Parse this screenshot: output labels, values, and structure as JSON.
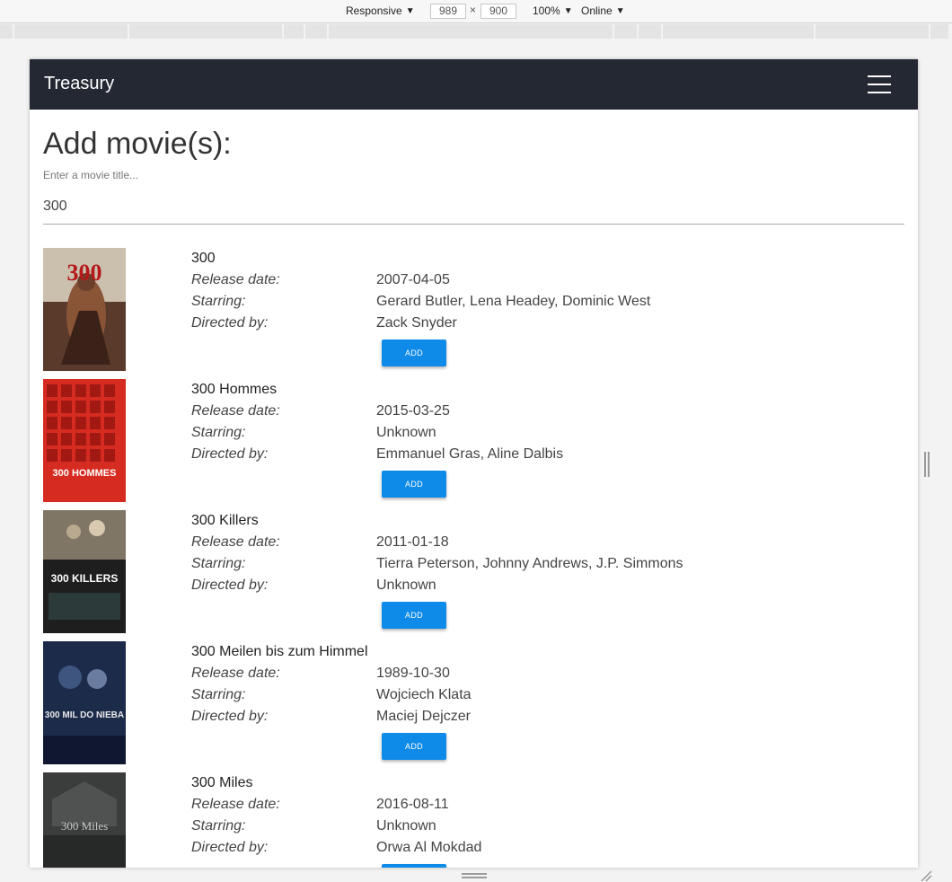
{
  "devtools": {
    "device_mode": "Responsive",
    "width": "989",
    "height": "900",
    "times": "×",
    "zoom": "100%",
    "throttle": "Online",
    "caret": "▼"
  },
  "app": {
    "brand": "Treasury"
  },
  "page": {
    "title": "Add movie(s):",
    "search_label": "Enter a movie title...",
    "search_value": "300"
  },
  "labels": {
    "release": "Release date:",
    "starring": "Starring:",
    "directed": "Directed by:",
    "add": "ADD"
  },
  "movies": [
    {
      "title": "300",
      "release": "2007-04-05",
      "starring": "Gerard Butler, Lena Headey, Dominic West",
      "directed": "Zack Snyder",
      "poster_text": "300"
    },
    {
      "title": "300 Hommes",
      "release": "2015-03-25",
      "starring": "Unknown",
      "directed": "Emmanuel Gras, Aline Dalbis",
      "poster_text": "300 HOMMES"
    },
    {
      "title": "300 Killers",
      "release": "2011-01-18",
      "starring": "Tierra Peterson, Johnny Andrews, J.P. Simmons",
      "directed": "Unknown",
      "poster_text": "300 KILLERS"
    },
    {
      "title": "300 Meilen bis zum Himmel",
      "release": "1989-10-30",
      "starring": "Wojciech Klata",
      "directed": "Maciej Dejczer",
      "poster_text": "300 MIL DO NIEBA"
    },
    {
      "title": "300 Miles",
      "release": "2016-08-11",
      "starring": "Unknown",
      "directed": "Orwa Al Mokdad",
      "poster_text": "300 Miles"
    }
  ]
}
